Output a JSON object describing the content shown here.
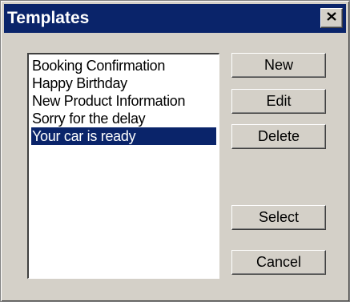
{
  "window": {
    "title": "Templates"
  },
  "close_icon": "close-icon",
  "templates_list": {
    "items": [
      "Booking Confirmation",
      "Happy Birthday",
      "New Product Information",
      "Sorry for the delay",
      "Your car is ready"
    ],
    "selected_index": 4
  },
  "buttons": {
    "new": "New",
    "edit": "Edit",
    "delete": "Delete",
    "select": "Select",
    "cancel": "Cancel"
  },
  "colors": {
    "titlebar": "#0a246a",
    "selection": "#0a246a",
    "face": "#d4d0c8"
  }
}
